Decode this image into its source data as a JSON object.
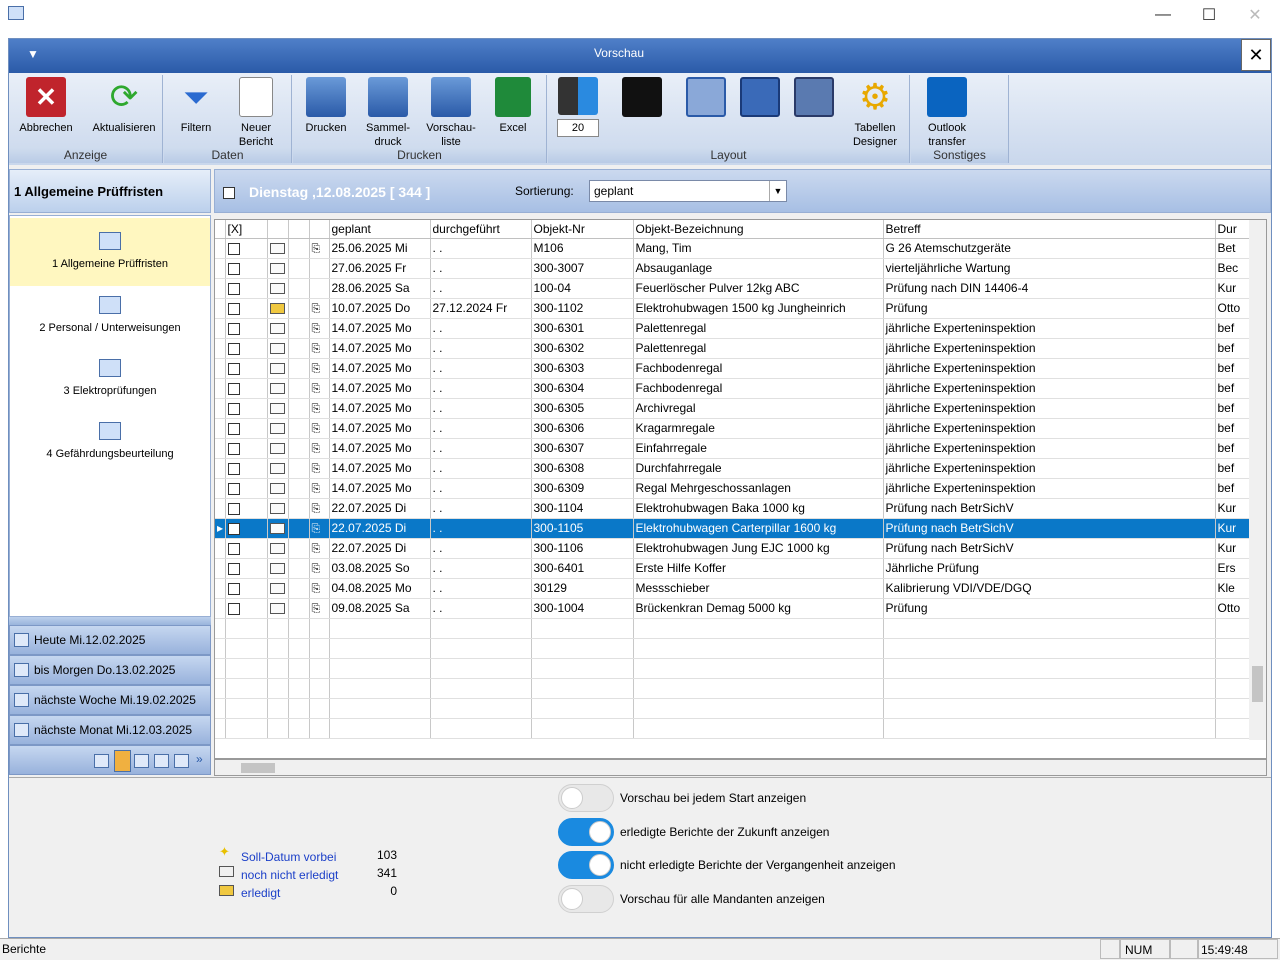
{
  "window": {
    "minimize": "—",
    "maximize": "☐",
    "close": "✕"
  },
  "child": {
    "title": "Vorschau",
    "close": "✕"
  },
  "ribbon": {
    "groups": [
      "Anzeige",
      "Daten",
      "Drucken",
      "Layout",
      "Sonstiges"
    ],
    "buttons": {
      "abbrechen": "Abbrechen",
      "aktualisieren": "Aktualisieren",
      "filtern": "Filtern",
      "neuer_bericht": "Neuer Bericht",
      "drucken": "Drucken",
      "sammeldruck": "Sammel- druck",
      "vorschauliste": "Vorschau- liste",
      "excel": "Excel",
      "spin_value": "20",
      "tabellen_designer": "Tabellen Designer",
      "outlook": "Outlook transfer"
    }
  },
  "sidebar": {
    "header": "1 Allgemeine Prüffristen",
    "items": [
      "1 Allgemeine Prüffristen",
      "2 Personal / Unterweisungen",
      "3 Elektroprüfungen",
      "4 Gefährdungsbeurteilung"
    ],
    "nav": [
      "Heute Mi.12.02.2025",
      "bis Morgen Do.13.02.2025",
      "nächste Woche Mi.19.02.2025",
      "nächste Monat Mi.12.03.2025"
    ]
  },
  "toolbar": {
    "date_title": "Dienstag ,12.08.2025  [ 344 ]",
    "sort_label": "Sortierung:",
    "sort_value": "geplant"
  },
  "grid": {
    "headers": [
      "[X]",
      "",
      "",
      "",
      "geplant",
      "durchgeführt",
      "Objekt-Nr",
      "Objekt-Bezeichnung",
      "Betreff",
      "Dur"
    ],
    "rows": [
      {
        "geplant": "25.06.2025 Mi",
        "durch": " . .",
        "nr": "M106",
        "bez": "Mang, Tim",
        "betreff": "G 26 Atemschutzgeräte",
        "dur": "Bet",
        "mail": "open",
        "clip": "⎘"
      },
      {
        "geplant": "27.06.2025 Fr",
        "durch": " . .",
        "nr": "300-3007",
        "bez": "Absauganlage",
        "betreff": "vierteljährliche Wartung",
        "dur": "Bec",
        "mail": "open",
        "clip": ""
      },
      {
        "geplant": "28.06.2025 Sa",
        "durch": " . .",
        "nr": "100-04",
        "bez": "Feuerlöscher Pulver 12kg ABC",
        "betreff": "Prüfung nach DIN 14406-4",
        "dur": "Kur",
        "mail": "open",
        "clip": ""
      },
      {
        "geplant": "10.07.2025 Do",
        "durch": "27.12.2024 Fr",
        "nr": "300-1102",
        "bez": "Elektrohubwagen 1500 kg  Jungheinrich",
        "betreff": "Prüfung",
        "dur": "Otto",
        "mail": "closed",
        "clip": "⎘"
      },
      {
        "geplant": "14.07.2025 Mo",
        "durch": " . .",
        "nr": "300-6301",
        "bez": "Palettenregal",
        "betreff": "jährliche Experteninspektion",
        "dur": "bef",
        "mail": "open",
        "clip": "⎘"
      },
      {
        "geplant": "14.07.2025 Mo",
        "durch": " . .",
        "nr": "300-6302",
        "bez": "Palettenregal",
        "betreff": "jährliche Experteninspektion",
        "dur": "bef",
        "mail": "open",
        "clip": "⎘"
      },
      {
        "geplant": "14.07.2025 Mo",
        "durch": " . .",
        "nr": "300-6303",
        "bez": "Fachbodenregal",
        "betreff": "jährliche Experteninspektion",
        "dur": "bef",
        "mail": "open",
        "clip": "⎘"
      },
      {
        "geplant": "14.07.2025 Mo",
        "durch": " . .",
        "nr": "300-6304",
        "bez": "Fachbodenregal",
        "betreff": "jährliche Experteninspektion",
        "dur": "bef",
        "mail": "open",
        "clip": "⎘"
      },
      {
        "geplant": "14.07.2025 Mo",
        "durch": " . .",
        "nr": "300-6305",
        "bez": "Archivregal",
        "betreff": "jährliche Experteninspektion",
        "dur": "bef",
        "mail": "open",
        "clip": "⎘"
      },
      {
        "geplant": "14.07.2025 Mo",
        "durch": " . .",
        "nr": "300-6306",
        "bez": "Kragarmregale",
        "betreff": "jährliche Experteninspektion",
        "dur": "bef",
        "mail": "open",
        "clip": "⎘"
      },
      {
        "geplant": "14.07.2025 Mo",
        "durch": " . .",
        "nr": "300-6307",
        "bez": "Einfahrregale",
        "betreff": "jährliche Experteninspektion",
        "dur": "bef",
        "mail": "open",
        "clip": "⎘"
      },
      {
        "geplant": "14.07.2025 Mo",
        "durch": " . .",
        "nr": "300-6308",
        "bez": "Durchfahrregale",
        "betreff": "jährliche Experteninspektion",
        "dur": "bef",
        "mail": "open",
        "clip": "⎘"
      },
      {
        "geplant": "14.07.2025 Mo",
        "durch": " . .",
        "nr": "300-6309",
        "bez": "Regal Mehrgeschossanlagen",
        "betreff": "jährliche Experteninspektion",
        "dur": "bef",
        "mail": "open",
        "clip": "⎘"
      },
      {
        "geplant": "22.07.2025 Di",
        "durch": " . .",
        "nr": "300-1104",
        "bez": "Elektrohubwagen Baka 1000 kg",
        "betreff": "Prüfung nach BetrSichV",
        "dur": "Kur",
        "mail": "open",
        "clip": "⎘"
      },
      {
        "geplant": "22.07.2025 Di",
        "durch": " . .",
        "nr": "300-1105",
        "bez": "Elektrohubwagen Carterpillar 1600 kg",
        "betreff": "Prüfung nach BetrSichV",
        "dur": "Kur",
        "mail": "open",
        "clip": "⎘",
        "selected": true
      },
      {
        "geplant": "22.07.2025 Di",
        "durch": " . .",
        "nr": "300-1106",
        "bez": "Elektrohubwagen Jung EJC 1000 kg",
        "betreff": "Prüfung nach BetrSichV",
        "dur": "Kur",
        "mail": "open",
        "clip": "⎘"
      },
      {
        "geplant": "03.08.2025 So",
        "durch": " . .",
        "nr": "300-6401",
        "bez": "Erste Hilfe Koffer",
        "betreff": "Jährliche Prüfung",
        "dur": "Ers",
        "mail": "open",
        "clip": "⎘"
      },
      {
        "geplant": "04.08.2025 Mo",
        "durch": " . .",
        "nr": "30129",
        "bez": "Messschieber",
        "betreff": "Kalibrierung VDI/VDE/DGQ",
        "dur": "Kle",
        "mail": "open",
        "clip": "⎘"
      },
      {
        "geplant": "09.08.2025 Sa",
        "durch": " . .",
        "nr": "300-1004",
        "bez": "Brückenkran Demag 5000 kg",
        "betreff": "Prüfung",
        "dur": "Otto",
        "mail": "open",
        "clip": "⎘"
      }
    ]
  },
  "legend": [
    {
      "label": "Soll-Datum vorbei",
      "value": "103"
    },
    {
      "label": "noch nicht erledigt",
      "value": "341"
    },
    {
      "label": "erledigt",
      "value": "0"
    }
  ],
  "toggles": [
    {
      "label": "Vorschau bei jedem Start anzeigen",
      "on": false
    },
    {
      "label": "erledigte Berichte der Zukunft anzeigen",
      "on": true
    },
    {
      "label": "nicht erledigte Berichte der Vergangenheit anzeigen",
      "on": true
    },
    {
      "label": "Vorschau für alle Mandanten anzeigen",
      "on": false
    }
  ],
  "status": {
    "left": "Berichte",
    "num": "NUM",
    "time": "15:49:48"
  },
  "colors": {
    "selection": "#0a78c8",
    "title": "#2a5aa8",
    "toggle_on": "#1a8ae0"
  }
}
